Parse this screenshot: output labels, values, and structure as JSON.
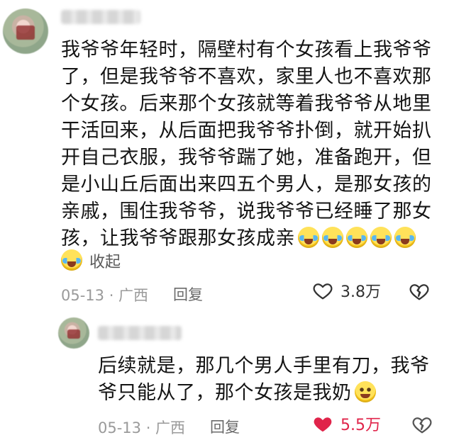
{
  "main_comment": {
    "lines": [
      "我爷爷年轻时，隔壁村有个女孩看上我爷爷",
      "了，但是我爷爷不喜欢，家里人也不喜欢那",
      "个女孩。后来那个女孩就等着我爷爷从地里",
      "干活回来，从后面把我爷爷扑倒，就开始扒",
      "开自己衣服，我爷爷踹了她，准备跑开，但",
      "是小山丘后面出来四五个男人，是那女孩的",
      "亲戚，围住我爷爷，说我爷爷已经睡了那女",
      "孩，让我爷爷跟那女孩成亲"
    ],
    "trailing_emojis": [
      "crying-laughing-icon",
      "crying-laughing-icon",
      "crying-laughing-icon",
      "crying-laughing-icon",
      "crying-laughing-icon"
    ],
    "collapse_label": "收起",
    "date": "05-13 · 广西",
    "reply_label": "回复",
    "like_count": "3.8万",
    "liked": false
  },
  "reply_comment": {
    "lines": [
      "后续就是，那几个男人手里有刀，我爷",
      "爷只能从了，那个女孩是我奶"
    ],
    "trailing_emoji": "smile-icon",
    "date": "05-13 · 广西",
    "reply_label": "回复",
    "like_count": "5.5万",
    "liked": true
  },
  "colors": {
    "liked_heart": "#e0244a",
    "meta_text": "#9a9a9a",
    "body_text": "#141414"
  }
}
